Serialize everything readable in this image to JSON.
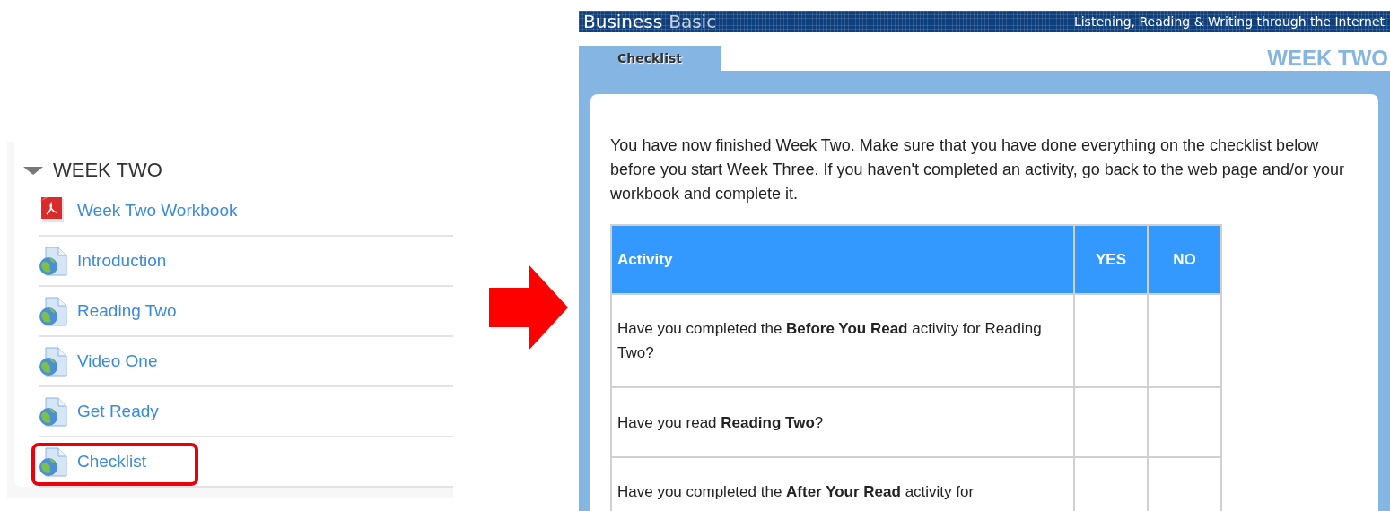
{
  "course_section": {
    "title": "WEEK TWO",
    "expanded": true,
    "items": [
      {
        "label": "Week Two Workbook",
        "kind": "pdf",
        "highlighted": false
      },
      {
        "label": "Introduction",
        "kind": "page",
        "highlighted": false
      },
      {
        "label": "Reading Two",
        "kind": "page",
        "highlighted": false
      },
      {
        "label": "Video One",
        "kind": "page",
        "highlighted": false
      },
      {
        "label": "Get Ready",
        "kind": "page",
        "highlighted": false
      },
      {
        "label": "Checklist",
        "kind": "page",
        "highlighted": true
      }
    ]
  },
  "checklist_page": {
    "header": {
      "brand_bold": "Business",
      "brand_light": "Basic",
      "tagline": "Listening, Reading & Writing through the Internet"
    },
    "tabs": [
      {
        "label": "Checklist",
        "selected": true
      }
    ],
    "week_label": "WEEK TWO",
    "intro": "You have now finished Week Two. Make sure that you have done everything on the checklist below before you start Week Three. If you haven't completed an activity, go back to the web page and/or your workbook and complete it.",
    "table": {
      "columns": [
        "Activity",
        "YES",
        "NO"
      ],
      "rows": [
        {
          "activity": "Have you completed the **Before You Read** activity for Reading Two?"
        },
        {
          "activity": "Have you read **Reading Two**?"
        },
        {
          "activity": "Have you completed the **After Your Read** activity for"
        }
      ]
    }
  }
}
